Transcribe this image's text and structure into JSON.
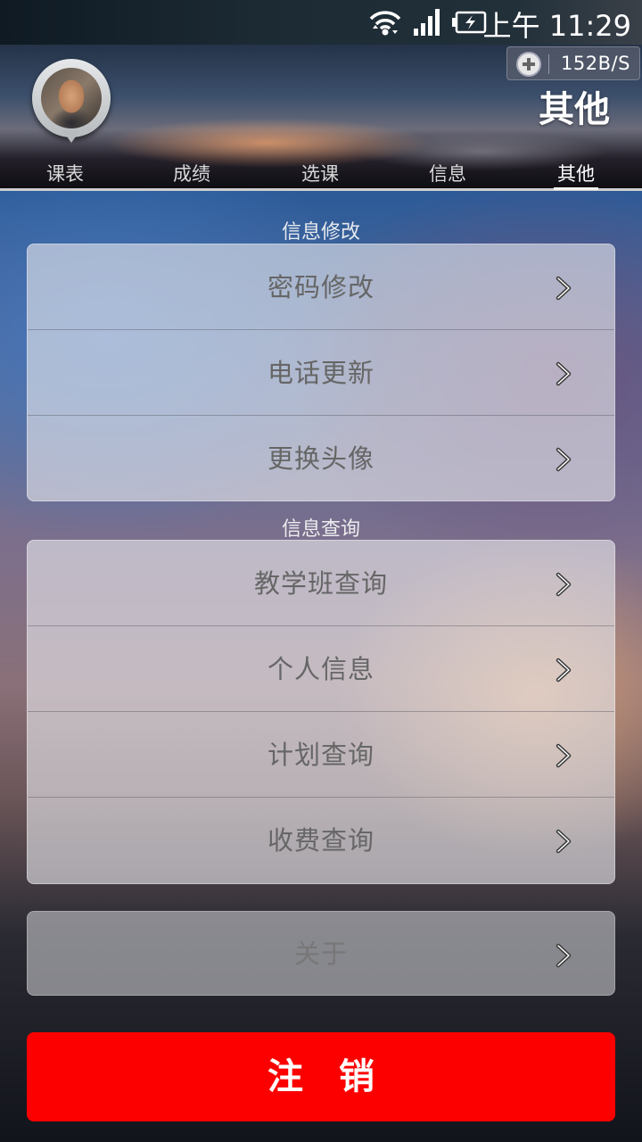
{
  "status_bar": {
    "time": "上午 11:29",
    "net_speed": "152B/S",
    "icons": [
      "wifi-icon",
      "signal-icon",
      "battery-charging-icon",
      "plus-icon"
    ]
  },
  "header": {
    "title": "其他",
    "tabs": [
      {
        "label": "课表"
      },
      {
        "label": "成绩"
      },
      {
        "label": "选课"
      },
      {
        "label": "信息"
      },
      {
        "label": "其他",
        "active": true
      }
    ]
  },
  "sections": {
    "modify": {
      "label": "信息修改",
      "items": [
        "密码修改",
        "电话更新",
        "更换头像"
      ]
    },
    "query": {
      "label": "信息查询",
      "items": [
        "教学班查询",
        "个人信息",
        "计划查询",
        "收费查询"
      ]
    },
    "about": {
      "label": "关于"
    }
  },
  "logout_label": "注　销",
  "colors": {
    "logout": "#fc0000",
    "row_text": "#666666",
    "active_tab_indicator": "#ffffff"
  }
}
